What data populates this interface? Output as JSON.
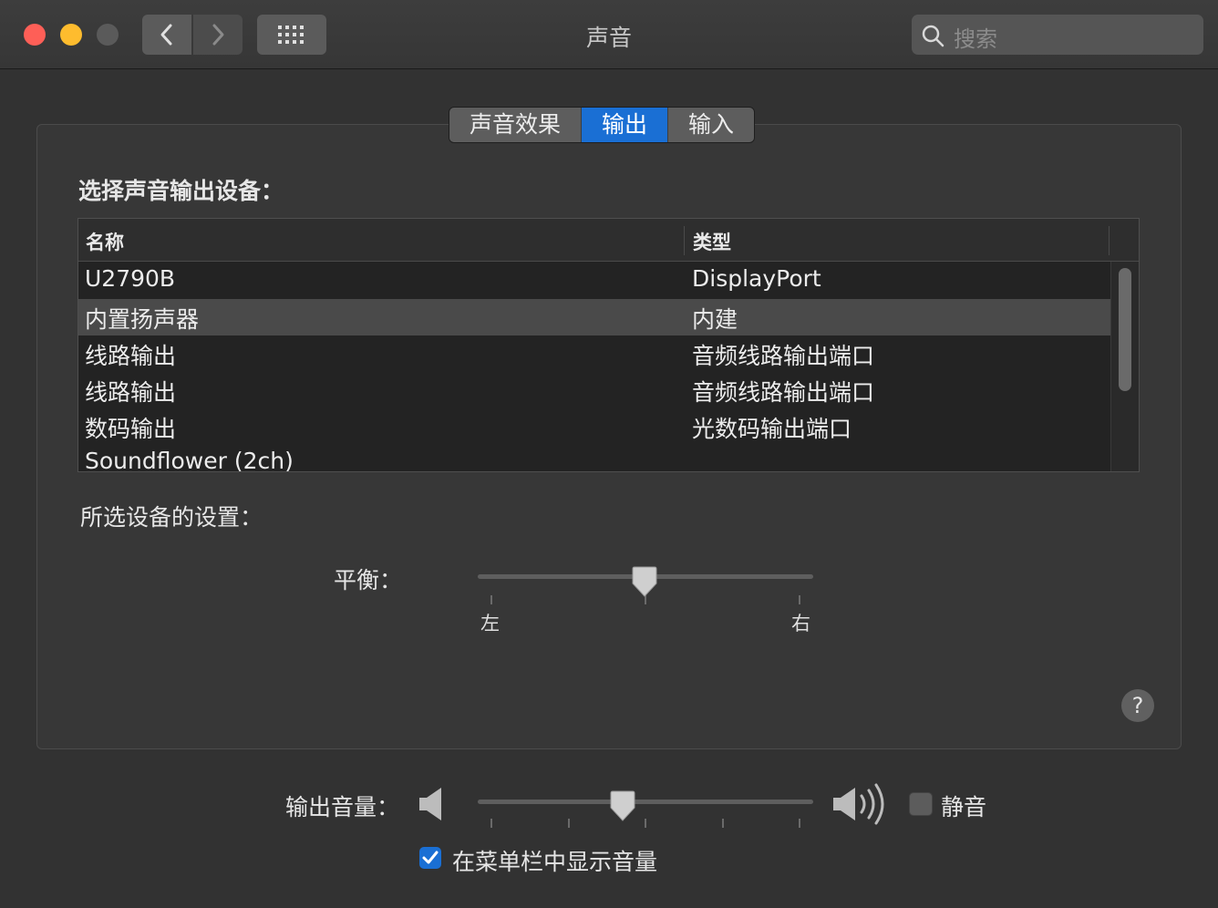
{
  "window": {
    "title": "声音",
    "search_placeholder": "搜索"
  },
  "tabs": [
    {
      "label": "声音效果",
      "active": false
    },
    {
      "label": "输出",
      "active": true
    },
    {
      "label": "输入",
      "active": false
    }
  ],
  "output": {
    "choose_label": "选择声音输出设备：",
    "columns": {
      "name": "名称",
      "type": "类型"
    },
    "devices": [
      {
        "name": "U2790B",
        "type": "DisplayPort",
        "selected": false
      },
      {
        "name": "内置扬声器",
        "type": "内建",
        "selected": true
      },
      {
        "name": "线路输出",
        "type": "音频线路输出端口",
        "selected": false
      },
      {
        "name": "线路输出",
        "type": "音频线路输出端口",
        "selected": false
      },
      {
        "name": "数码输出",
        "type": "光数码输出端口",
        "selected": false
      },
      {
        "name": "Soundflower (2ch)",
        "type": "",
        "selected": false
      }
    ],
    "settings_label": "所选设备的设置：",
    "balance": {
      "label": "平衡：",
      "left": "左",
      "right": "右",
      "value": 0.5
    }
  },
  "volume": {
    "label": "输出音量：",
    "value": 0.43,
    "mute_label": "静音",
    "mute_checked": false,
    "show_in_menubar_label": "在菜单栏中显示音量",
    "show_in_menubar_checked": true
  },
  "colors": {
    "accent": "#1a6fd4",
    "window_bg": "#323232",
    "close": "#fe5f57",
    "minimize": "#febc2e"
  }
}
